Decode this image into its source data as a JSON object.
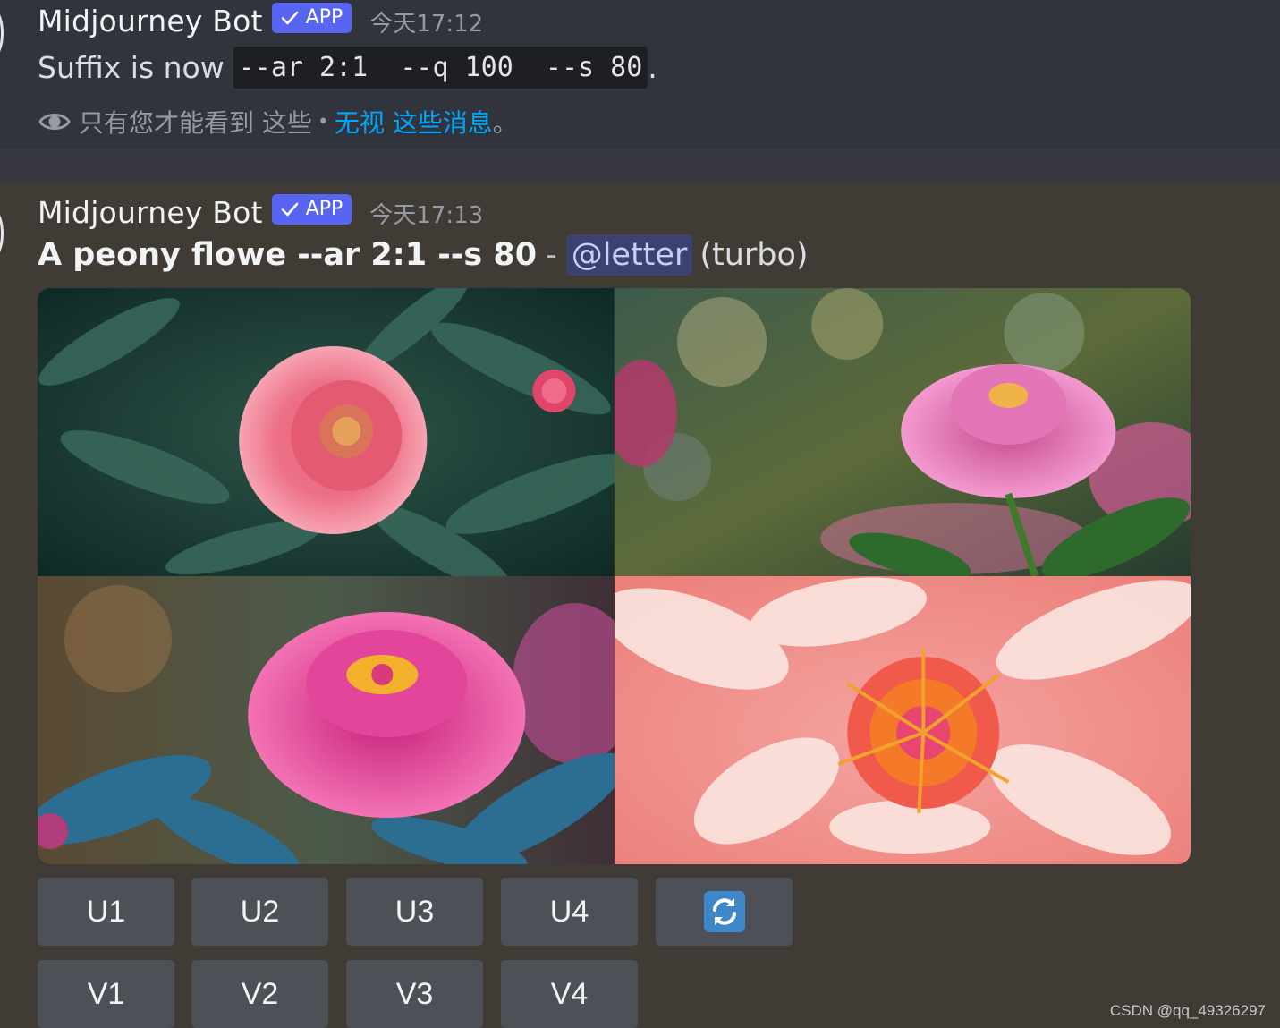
{
  "message1": {
    "username": "Midjourney Bot",
    "badge": "APP",
    "timestamp": "今天17:12",
    "text_prefix": "Suffix is now",
    "code": "--ar 2:1  --q 100  --s 80",
    "text_suffix": ".",
    "ephemeral_notice": "只有您才能看到 这些",
    "ephemeral_sep": "•",
    "dismiss_link": "无视 这些消息",
    "ephemeral_end": "。"
  },
  "message2": {
    "username": "Midjourney Bot",
    "badge": "APP",
    "timestamp": "今天17:13",
    "prompt": "A peony flowe --ar 2:1 --s 80",
    "separator": "-",
    "mention": "@letter",
    "mode": "(turbo)",
    "images": [
      {
        "icon": "peony-image-1"
      },
      {
        "icon": "peony-image-2"
      },
      {
        "icon": "peony-image-3"
      },
      {
        "icon": "peony-image-4"
      }
    ],
    "buttons_row1": [
      "U1",
      "U2",
      "U3",
      "U4"
    ],
    "reroll_icon": "refresh-icon",
    "buttons_row2": [
      "V1",
      "V2",
      "V3",
      "V4"
    ]
  },
  "watermark": "CSDN @qq_49326297",
  "colors": {
    "background": "#413b35",
    "message_highlight": "#31333d",
    "accent": "#5865f2",
    "link": "#00a8fc",
    "button": "#4e5058"
  }
}
